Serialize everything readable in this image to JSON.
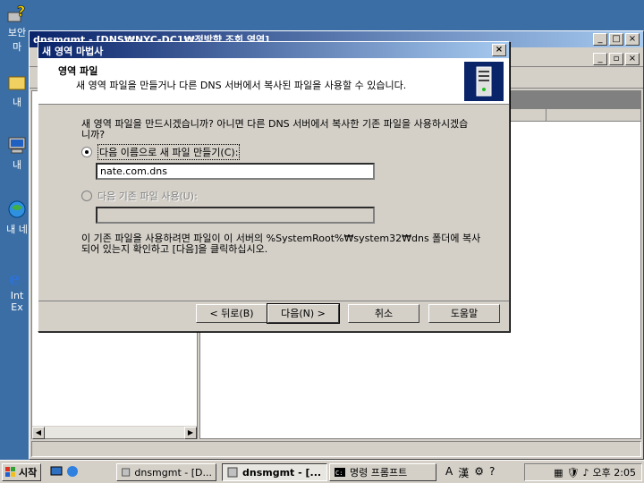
{
  "desktop": {
    "icons": [
      {
        "label": "보안",
        "label2": "마",
        "icon": "help-icon"
      },
      {
        "label": "내",
        "icon": "my-documents-icon"
      },
      {
        "label": "내",
        "icon": "my-computer-icon"
      },
      {
        "label": "내 네",
        "icon": "network-places-icon"
      },
      {
        "label": "Int",
        "label2": "Ex",
        "icon": "internet-explorer-icon"
      }
    ]
  },
  "mmc": {
    "title": "dnsmgmt - [DNS₩NYC-DC1₩정방향 조회 영역]"
  },
  "wizard": {
    "title": "새 영역 마법사",
    "header_title": "영역 파일",
    "header_subtitle": "새 영역 파일을 만들거나 다른 DNS 서버에서 복사된 파일을 사용할 수 있습니다.",
    "question": "새 영역 파일을 만드시겠습니까? 아니면 다른 DNS 서버에서 복사한 기존 파일을 사용하시겠습니까?",
    "option_new_label": "다음 이름으로 새 파일 만들기(C):",
    "option_new_value": "nate.com.dns",
    "option_existing_label": "다음 기존 파일 사용(U):",
    "option_existing_value": "",
    "note": "이 기존 파일을 사용하려면 파일이 이 서버의 %SystemRoot%₩system32₩dns 폴더에 복사되어 있는지 확인하고 [다음]을 클릭하십시오.",
    "buttons": {
      "back": "< 뒤로(B)",
      "next": "다음(N) >",
      "cancel": "취소",
      "help": "도움말"
    }
  },
  "taskbar": {
    "start": "시작",
    "tasks": [
      {
        "label": "dnsmgmt - [D...",
        "active": false
      },
      {
        "label": "dnsmgmt - [...",
        "active": true
      },
      {
        "label": "명령 프롬프트",
        "active": false
      }
    ],
    "ime": [
      "A",
      "漢"
    ],
    "clock": "오후 2:05"
  }
}
